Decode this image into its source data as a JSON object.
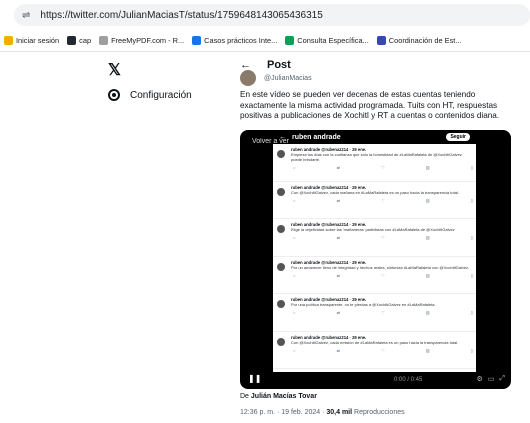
{
  "browser": {
    "url": "https://twitter.com/JulianMaciasT/status/1759648143065436315"
  },
  "bookmarks": [
    {
      "label": "Iniciar sesión",
      "icon": "sign-in-icon",
      "color": "#f9ab00"
    },
    {
      "label": "cap",
      "icon": "github-icon",
      "color": "#24292f"
    },
    {
      "label": "FreeMyPDF.com - R...",
      "icon": "pdf-icon",
      "color": "#9e9e9e"
    },
    {
      "label": "Casos prácticos Inte...",
      "icon": "doc-icon",
      "color": "#1a73e8"
    },
    {
      "label": "Consulta Específica...",
      "icon": "consulta-icon",
      "color": "#0f9d58"
    },
    {
      "label": "Coordinación de Est...",
      "icon": "coord-icon",
      "color": "#3949ab"
    }
  ],
  "nav": {
    "x_logo": "𝕏",
    "config_label": "Configuración"
  },
  "post": {
    "back_arrow": "←",
    "header": "Post",
    "handle": "@JulianMacias",
    "text": "En este vídeo se pueden ver decenas de estas cuentas teniendo exactamente la misma actividad programada. Tuits con HT, respuestas positivas a publicaciones de Xochitl y RT a cuentas o contenidos diana.",
    "byline_prefix": "De ",
    "byline_author": "Julián Macías Tovar",
    "timestamp": "12:36 p. m. · 19 feb. 2024 · ",
    "views_count": "30,4 mil",
    "views_label": " Reproducciones"
  },
  "video": {
    "watch_again": "Volver a ver",
    "header_name": "ruben andrade",
    "follow_label": "Seguir",
    "time": "0:00 / 0:45",
    "tweets": [
      {
        "name": "ruben andrade @rubenaz214 · 29 ene.",
        "text": "Empieza tus días con la confianza que sólo la honestidad de #LaMaRafaleta de @XochitlGalvez puede brindarte."
      },
      {
        "name": "ruben andrade @rubenaz214 · 29 ene.",
        "text": "Con @XochitlGalvez, cada mañana en #LaMaRafaleta es un paso hacia la transparencia total."
      },
      {
        "name": "ruben andrade @rubenaz214 · 29 ene.",
        "text": "Elige la objetividad sobre las 'mañaneras' partidistas con #LaMaRafaleta de @XochitlGalvez"
      },
      {
        "name": "ruben andrade @rubenaz214 · 29 ene.",
        "text": "Por un amanecer lleno de integridad y hechos reales, sintoniza #LaMaRafaleta con @XochitlGalvez."
      },
      {
        "name": "ruben andrade @rubenaz214 · 29 ene.",
        "text": "Por una política transparente, no te pierdas a @XochitlGalvez en #LaMaRafaleta."
      },
      {
        "name": "ruben andrade @rubenaz214 · 29 ene.",
        "text": "Con @XochitlGalvez, cada emisión de #LaMaRafaleta es un paso hacia la transparencia total."
      }
    ]
  }
}
